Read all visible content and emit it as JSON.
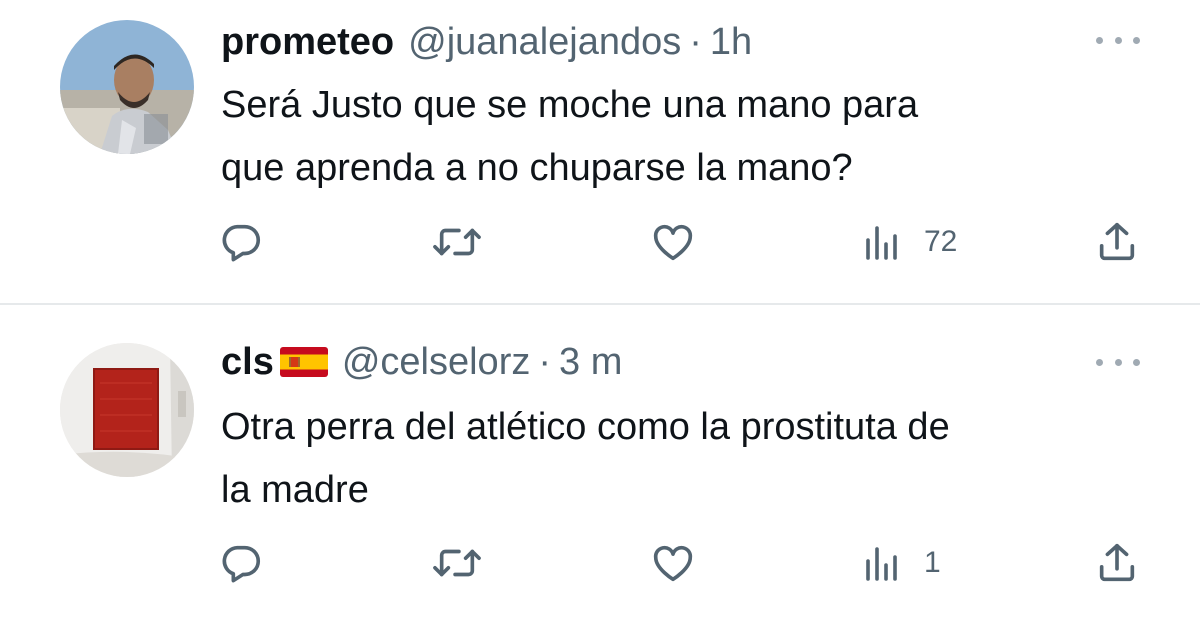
{
  "tweets": [
    {
      "display_name": "prometeo",
      "flag_emoji": "",
      "handle": "@juanalejandos",
      "separator": "·",
      "time": "1h",
      "text_lines": [
        "Será Justo que se moche una mano para",
        "que aprenda a no chuparse la mano?"
      ],
      "actions": {
        "reply_icon": "reply-icon",
        "retweet_icon": "retweet-icon",
        "like_icon": "heart-icon",
        "views_icon": "views-icon",
        "views_count": "72",
        "share_icon": "share-icon"
      }
    },
    {
      "display_name": "cls",
      "flag_emoji": "spain-flag",
      "handle": "@celselorz",
      "separator": "·",
      "time": "3 m",
      "text_lines": [
        "Otra perra del atlético como la prostituta de",
        "la madre"
      ],
      "actions": {
        "reply_icon": "reply-icon",
        "retweet_icon": "retweet-icon",
        "like_icon": "heart-icon",
        "views_icon": "views-icon",
        "views_count": "1",
        "share_icon": "share-icon"
      }
    }
  ],
  "colors": {
    "text": "#0f1419",
    "secondary": "#536471",
    "divider": "#e6e9eb",
    "icon": "#536471"
  }
}
